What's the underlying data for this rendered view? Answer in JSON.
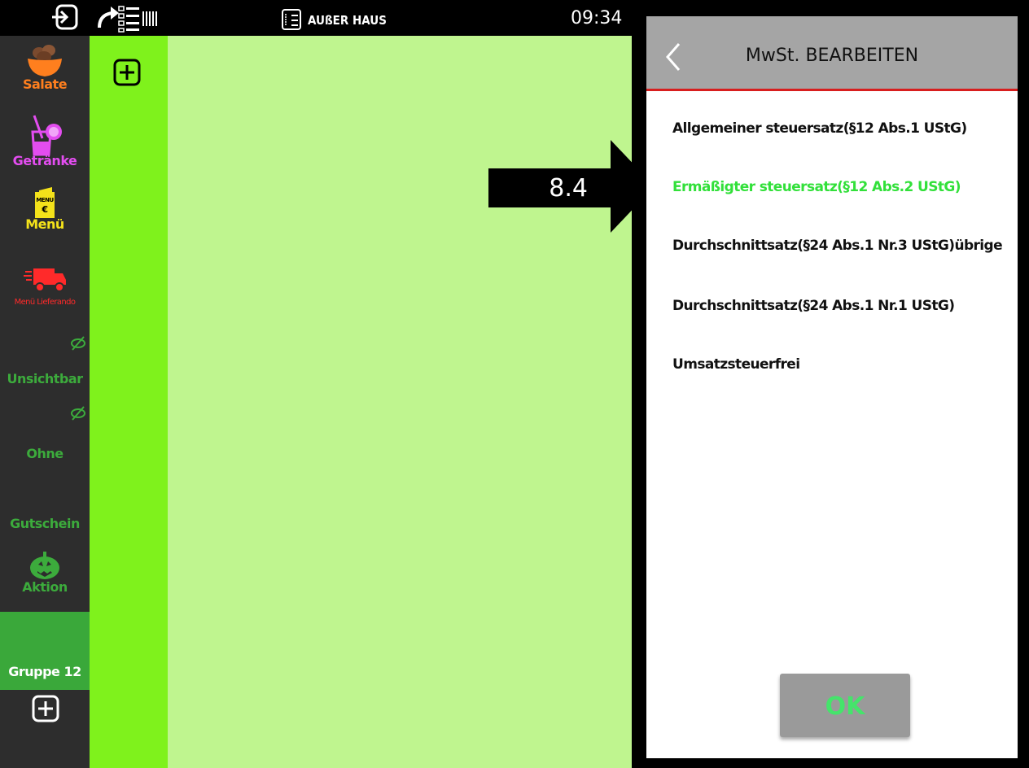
{
  "topbar": {
    "mode_label": "AUßER HAUS",
    "time": "09:34",
    "icons": [
      "exit-icon",
      "redirect-list-icon",
      "order-list-icon"
    ]
  },
  "sidebar": {
    "items": [
      {
        "label": "Salate",
        "color": "#ff7f1e",
        "icon": "salad-bowl-icon"
      },
      {
        "label": "Getränke",
        "color": "#e34df0",
        "icon": "drink-icon"
      },
      {
        "label": "Menü",
        "color": "#f4e21a",
        "icon": "menu-card-icon"
      },
      {
        "label": "Menü Lieferando",
        "color": "#ff2a2a",
        "icon": "delivery-truck-icon"
      },
      {
        "label": "Unsichtbar",
        "color": "#3cab3c",
        "icon": "eye-slash-icon"
      },
      {
        "label": "Ohne",
        "color": "#3cab3c",
        "icon": "eye-slash-icon"
      },
      {
        "label": "Gutschein",
        "color": "#3cab3c",
        "icon": ""
      },
      {
        "label": "Aktion",
        "color": "#3cab3c",
        "icon": "pumpkin-icon"
      },
      {
        "label": "Gruppe 12",
        "color": "#ffffff",
        "icon": ""
      }
    ],
    "add_icon": "plus-box-icon"
  },
  "itemcol": {
    "add_icon": "plus-box-icon"
  },
  "dialog": {
    "title": "MwSt. BEARBEITEN",
    "back_icon": "chevron-left-icon",
    "options": [
      {
        "label": "Allgemeiner steuersatz(§12 Abs.1 UStG)",
        "selected": false
      },
      {
        "label": "Ermäßigter steuersatz(§12 Abs.2 UStG)",
        "selected": true
      },
      {
        "label": "Durchschnittsatz(§24 Abs.1 Nr.3 UStG)übrige",
        "selected": false
      },
      {
        "label": "Durchschnittsatz(§24 Abs.1 Nr.1 UStG)",
        "selected": false
      },
      {
        "label": "Umsatzsteuerfrei",
        "selected": false
      }
    ],
    "ok_label": "OK",
    "accent": "#d81e1e",
    "selected_color": "#32e03a"
  },
  "annotation": {
    "label": "8.4"
  }
}
